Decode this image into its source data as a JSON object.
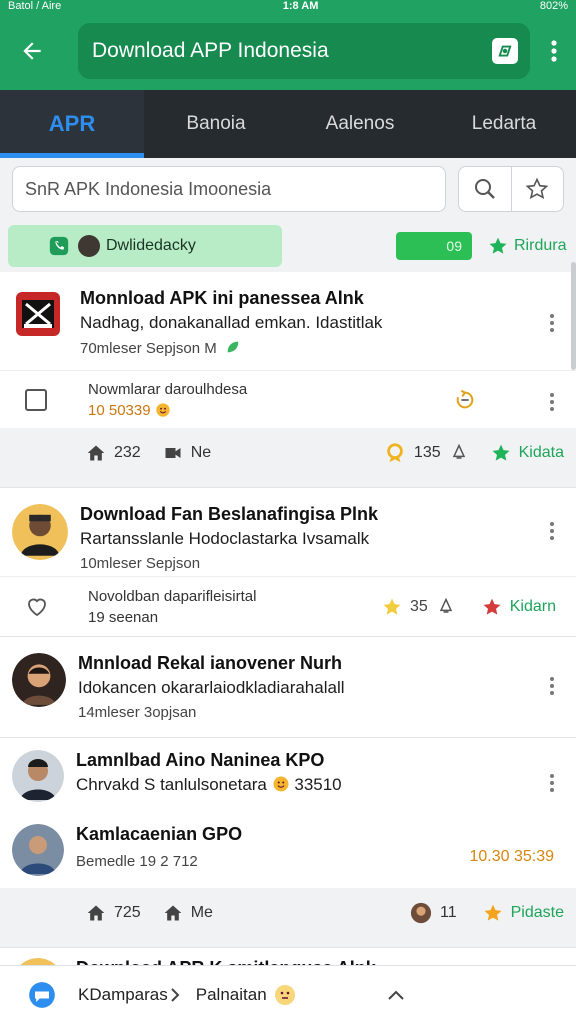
{
  "status": {
    "carrier": "Batol / Aire",
    "time": "1:8 AM",
    "battery": "802%"
  },
  "header": {
    "title": "Download APP Indonesia"
  },
  "tabs": [
    {
      "label": "APR",
      "active": true
    },
    {
      "label": "Banoia",
      "active": false
    },
    {
      "label": "Aalenos",
      "active": false
    },
    {
      "label": "Ledarta",
      "active": false
    }
  ],
  "search": {
    "value": "SnR APK Indonesia Imoonesia"
  },
  "filter": {
    "chip_label": "Dwlidedacky",
    "count": "09",
    "star_label": "Rirdura"
  },
  "posts": [
    {
      "title": "Monnload APK ini panessea Alnk",
      "text": "Nadhag, donakanallad emkan. Idastitlak",
      "meta": "70mleser Sepjson M",
      "sub_line1": "Nowmlarar daroulhdesa",
      "sub_line2": "10 50339",
      "actions": {
        "likes": "232",
        "shares": "Ne",
        "reactions": "135",
        "star_label": "Kidata"
      }
    },
    {
      "title": "Download Fan Beslanafingisa Plnk",
      "text": "Rartansslanle Hodoclastarka Ivsamalk",
      "meta": "10mleser Sepjson",
      "sub_line1": "Novoldban daparifleisirtal",
      "sub_line2": "19 seenan",
      "sub_count": "35",
      "sub_star_label": "Kidarn"
    },
    {
      "title": "Mnnload Rekal ianovener Nurh",
      "text": "Idokancen okararlaiodkladiarahalall",
      "meta": "14mleser 3opjsan"
    },
    {
      "title": "Lamnlbad Aino Naninea KPO",
      "text": "Chrvakd S tanlulsonetara",
      "text_count": "33510"
    },
    {
      "title": "Kamlacaenian GPO",
      "meta": "Bemedle 19 2 712",
      "time": "10.30 35:39",
      "actions": {
        "likes": "725",
        "shares": "Me",
        "reactions": "11",
        "star_label": "Pidaste"
      }
    },
    {
      "title": "Download APR K smitlangusa Alnk"
    }
  ],
  "bottom": {
    "left_label": "KDamparas",
    "mid_label": "Palnaitan"
  }
}
